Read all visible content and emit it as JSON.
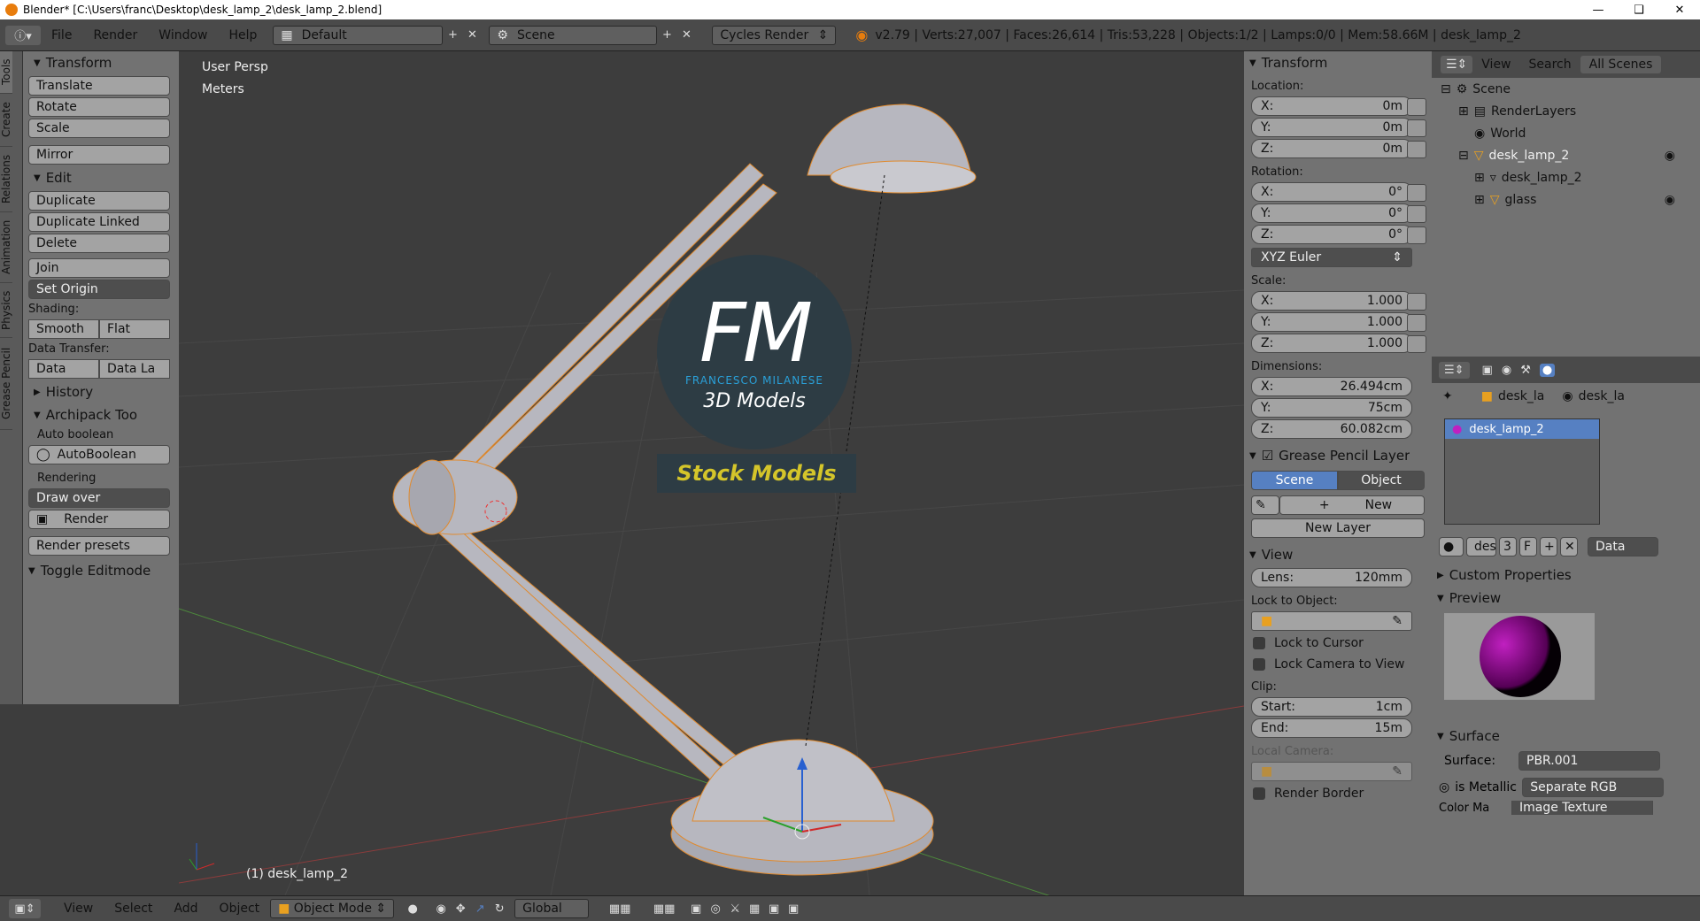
{
  "window": {
    "title": "Blender* [C:\\Users\\franc\\Desktop\\desk_lamp_2\\desk_lamp_2.blend]"
  },
  "topbar": {
    "menus": [
      "File",
      "Render",
      "Window",
      "Help"
    ],
    "layout": "Default",
    "scene": "Scene",
    "engine": "Cycles Render",
    "stats": "v2.79 | Verts:27,007 | Faces:26,614 | Tris:53,228 | Objects:1/2 | Lamps:0/0 | Mem:58.66M | desk_lamp_2"
  },
  "left_tabs": [
    "Tools",
    "Create",
    "Relations",
    "Animation",
    "Physics",
    "Grease Pencil"
  ],
  "toolshelf": {
    "transform_title": "Transform",
    "translate": "Translate",
    "rotate": "Rotate",
    "scale": "Scale",
    "mirror": "Mirror",
    "edit_title": "Edit",
    "duplicate": "Duplicate",
    "duplicate_linked": "Duplicate Linked",
    "delete": "Delete",
    "join": "Join",
    "set_origin": "Set Origin",
    "shading_label": "Shading:",
    "smooth": "Smooth",
    "flat": "Flat",
    "data_transfer_label": "Data Transfer:",
    "data": "Data",
    "data_la": "Data La",
    "history": "History",
    "archipack": "Archipack Too",
    "auto_boolean": "Auto boolean",
    "autoboolean_btn": "AutoBoolean",
    "rendering": "Rendering",
    "draw_over": "Draw over",
    "render": "Render",
    "render_presets": "Render presets",
    "toggle_editmode": "Toggle Editmode"
  },
  "viewport": {
    "view_name": "User Persp",
    "units": "Meters",
    "object_label": "(1) desk_lamp_2",
    "watermark_letters": "FM",
    "watermark_name": "FRANCESCO MILANESE",
    "watermark_sub": "3D Models",
    "watermark_banner": "Stock Models"
  },
  "nprops": {
    "transform_title": "Transform",
    "location_label": "Location:",
    "location": [
      {
        "axis": "X:",
        "value": "0m"
      },
      {
        "axis": "Y:",
        "value": "0m"
      },
      {
        "axis": "Z:",
        "value": "0m"
      }
    ],
    "rotation_label": "Rotation:",
    "rotation": [
      {
        "axis": "X:",
        "value": "0°"
      },
      {
        "axis": "Y:",
        "value": "0°"
      },
      {
        "axis": "Z:",
        "value": "0°"
      }
    ],
    "rotation_mode": "XYZ Euler",
    "scale_label": "Scale:",
    "scale": [
      {
        "axis": "X:",
        "value": "1.000"
      },
      {
        "axis": "Y:",
        "value": "1.000"
      },
      {
        "axis": "Z:",
        "value": "1.000"
      }
    ],
    "dimensions_label": "Dimensions:",
    "dimensions": [
      {
        "axis": "X:",
        "value": "26.494cm"
      },
      {
        "axis": "Y:",
        "value": "75cm"
      },
      {
        "axis": "Z:",
        "value": "60.082cm"
      }
    ],
    "grease_title": "Grease Pencil Layer",
    "scene_tab": "Scene",
    "object_tab": "Object",
    "new": "New",
    "new_layer": "New Layer",
    "view_title": "View",
    "lens_label": "Lens:",
    "lens_value": "120mm",
    "lock_to_object": "Lock to Object:",
    "lock_to_cursor": "Lock to Cursor",
    "lock_camera": "Lock Camera to View",
    "clip_label": "Clip:",
    "clip_start_label": "Start:",
    "clip_start": "1cm",
    "clip_end_label": "End:",
    "clip_end": "15m",
    "local_camera": "Local Camera:",
    "render_border": "Render Border"
  },
  "outliner": {
    "view": "View",
    "search": "Search",
    "filter": "All Scenes",
    "rows": [
      "Scene",
      "RenderLayers",
      "World",
      "desk_lamp_2",
      "desk_lamp_2",
      "glass"
    ]
  },
  "properties": {
    "breadcrumb_a": "desk_la",
    "breadcrumb_b": "desk_la",
    "material_slot": "desk_lamp_2",
    "mat_name": "des",
    "mat_users": "3",
    "mat_f": "F",
    "data_select": "Data",
    "custom_props": "Custom Properties",
    "preview": "Preview",
    "surface_title": "Surface",
    "surface_label": "Surface:",
    "surface_value": "PBR.001",
    "is_metallic": "is Metallic",
    "separate_rgb": "Separate RGB",
    "colour_label": "Color Ma",
    "image_texture": "Image Texture"
  },
  "bottombar": {
    "menus": [
      "View",
      "Select",
      "Add",
      "Object"
    ],
    "mode": "Object Mode",
    "orientation": "Global"
  }
}
